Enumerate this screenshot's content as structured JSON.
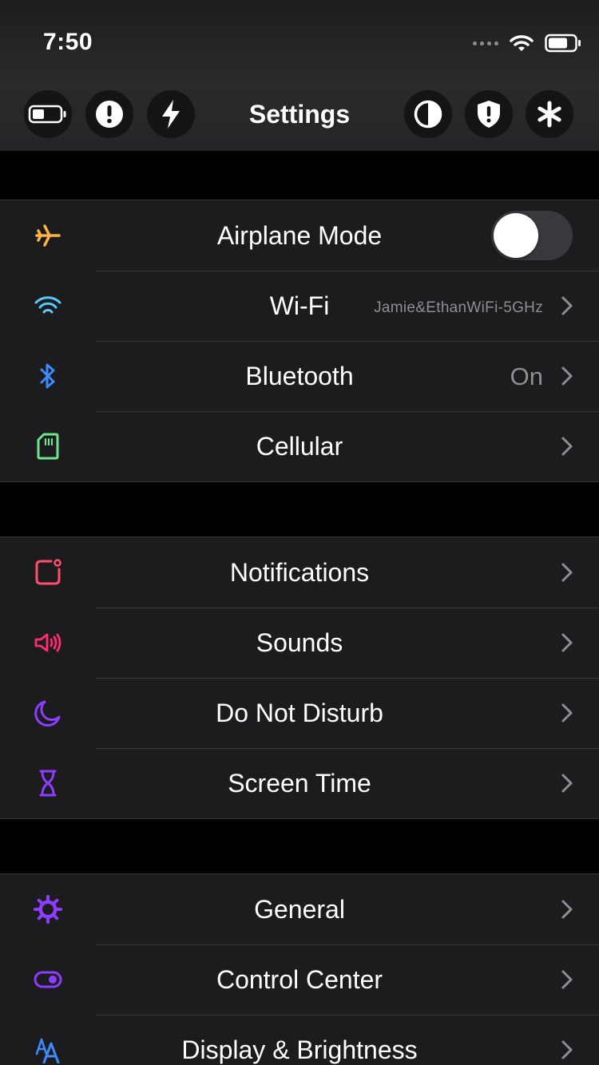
{
  "status_bar": {
    "time": "7:50"
  },
  "nav": {
    "title": "Settings"
  },
  "toolbar_icons": {
    "left": [
      "battery-icon",
      "alert-icon",
      "bolt-icon"
    ],
    "right": [
      "contrast-icon",
      "shield-alert-icon",
      "asterisk-icon"
    ]
  },
  "groups": [
    {
      "rows": [
        {
          "label": "Airplane Mode",
          "icon": "airplane-icon",
          "icon_color": "#ffb340",
          "control": "toggle",
          "toggle_on": false
        },
        {
          "label": "Wi-Fi",
          "icon": "wifi-icon",
          "icon_color": "#5ac8fa",
          "value": "Jamie&EthanWiFi-5GHz"
        },
        {
          "label": "Bluetooth",
          "icon": "bluetooth-icon",
          "icon_color": "#3d8bff",
          "value": "On"
        },
        {
          "label": "Cellular",
          "icon": "sim-card-icon",
          "icon_color": "#6fe38e"
        }
      ]
    },
    {
      "rows": [
        {
          "label": "Notifications",
          "icon": "notification-icon",
          "icon_color": "#ff4f6d"
        },
        {
          "label": "Sounds",
          "icon": "speaker-icon",
          "icon_color": "#ff2d6f"
        },
        {
          "label": "Do Not Disturb",
          "icon": "moon-icon",
          "icon_color": "#8e3dff"
        },
        {
          "label": "Screen Time",
          "icon": "hourglass-icon",
          "icon_color": "#8e3dff"
        }
      ]
    },
    {
      "rows": [
        {
          "label": "General",
          "icon": "gear-icon",
          "icon_color": "#8e3dff"
        },
        {
          "label": "Control Center",
          "icon": "switch-icon",
          "icon_color": "#8e3dff"
        },
        {
          "label": "Display & Brightness",
          "icon": "text-size-icon",
          "icon_color": "#3d8bff"
        }
      ]
    }
  ]
}
